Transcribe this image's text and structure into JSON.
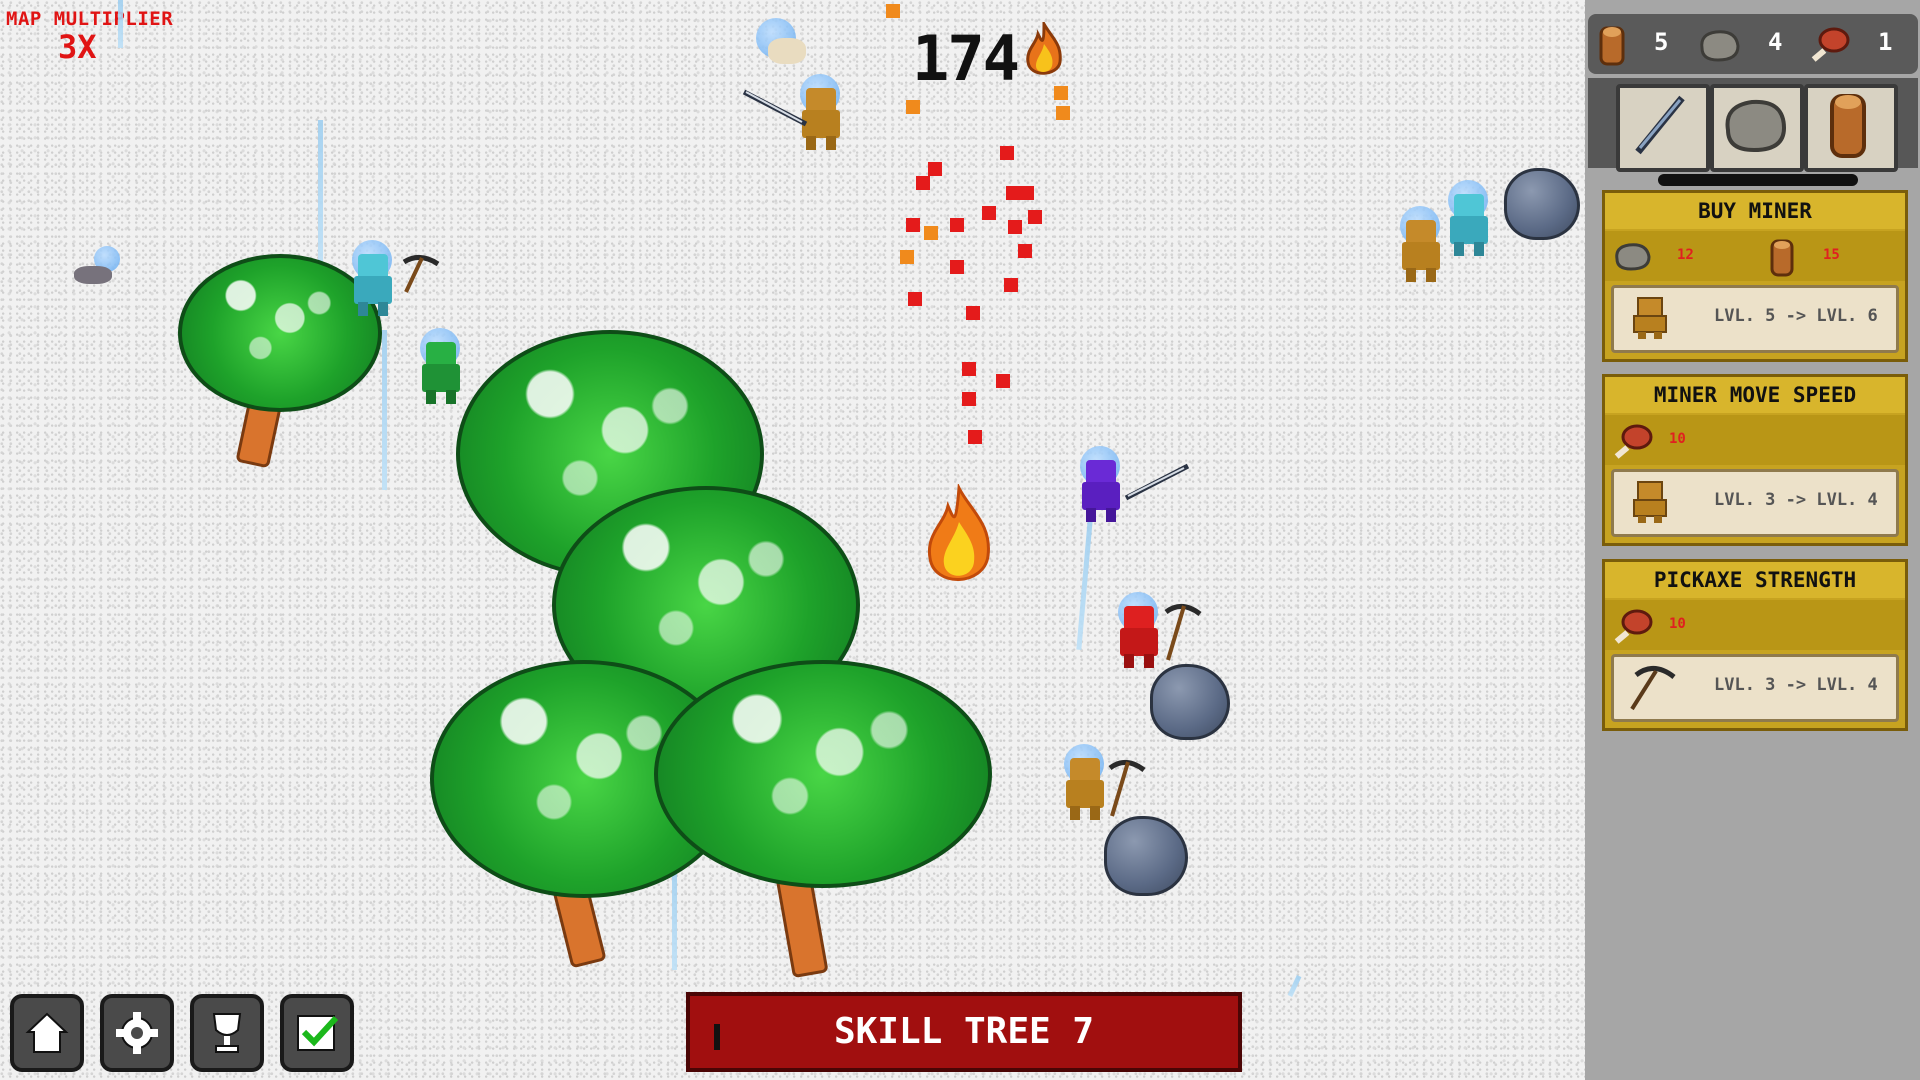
{
  "hud": {
    "map_multiplier_label": "MAP MULTIPLIER",
    "map_multiplier_value": "3X",
    "fire_count": "174"
  },
  "resources": [
    {
      "name": "wood-log-icon",
      "count": "5"
    },
    {
      "name": "stone-icon",
      "count": "4"
    },
    {
      "name": "meat-icon",
      "count": "1"
    }
  ],
  "tools": [
    "sword-icon",
    "stone-icon",
    "wood-log-icon"
  ],
  "upgrades": [
    {
      "title": "BUY MINER",
      "costs": [
        {
          "icon": "stone-icon",
          "amount": "12"
        },
        {
          "icon": "wood-log-icon",
          "amount": "15"
        }
      ],
      "level_text": "LVL. 5 -> LVL. 6",
      "level_icon": "miner-icon"
    },
    {
      "title": "MINER MOVE SPEED",
      "costs": [
        {
          "icon": "meat-icon",
          "amount": "10"
        }
      ],
      "level_text": "LVL. 3 -> LVL. 4",
      "level_icon": "miner-icon"
    },
    {
      "title": "PICKAXE STRENGTH",
      "costs": [
        {
          "icon": "meat-icon",
          "amount": "10"
        }
      ],
      "level_text": "LVL. 3 -> LVL. 4",
      "level_icon": "pickaxe-icon"
    }
  ],
  "bottom_bar": {
    "skill_tree_label": "SKILL TREE 7",
    "buttons": [
      "home-icon",
      "gear-icon",
      "trophy-icon",
      "check-icon"
    ]
  },
  "colors": {
    "accent_red": "#e01414",
    "card_gold": "#c7a320",
    "skill_button": "#a10f0f"
  }
}
